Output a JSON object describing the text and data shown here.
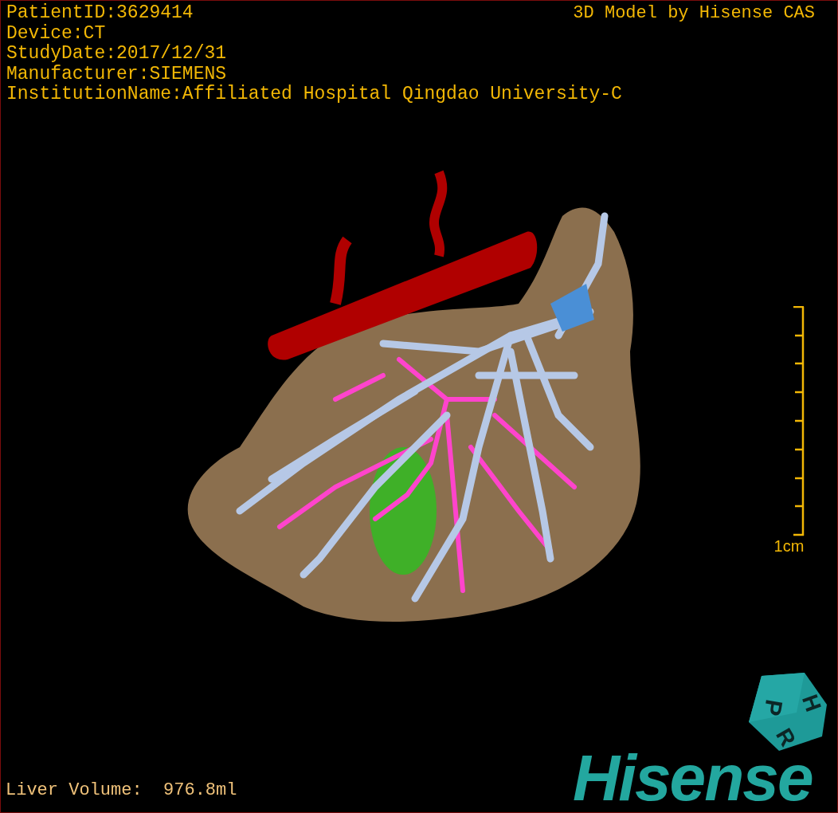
{
  "info_lines": [
    "PatientID:3629414",
    "Device:CT",
    "StudyDate:2017/12/31",
    "Manufacturer:SIEMENS",
    "InstitutionName:Affiliated Hospital Qingdao University-C"
  ],
  "title": "3D Model by Hisense CAS",
  "scale_bar": {
    "label": "1cm"
  },
  "measurement": "Liver Volume:  976.8ml",
  "orientation_cube": {
    "faces": [
      "P",
      "R",
      "H"
    ]
  },
  "logo": {
    "text": "Hisense"
  }
}
